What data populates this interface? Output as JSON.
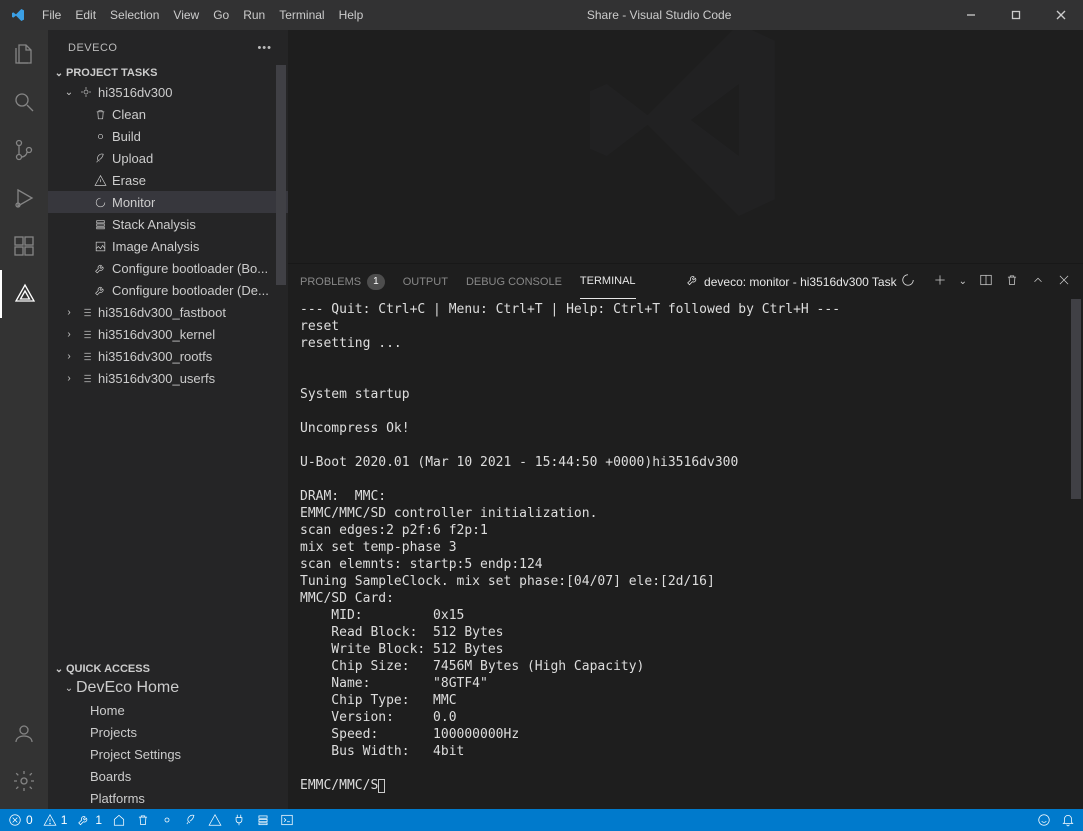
{
  "title": "Share - Visual Studio Code",
  "menu": [
    "File",
    "Edit",
    "Selection",
    "View",
    "Go",
    "Run",
    "Terminal",
    "Help"
  ],
  "sidebar_title": "DEVECO",
  "sections": {
    "project_tasks": "PROJECT TASKS",
    "quick_access": "QUICK ACCESS",
    "deveco_home": "DevEco Home"
  },
  "tree": {
    "root": "hi3516dv300",
    "tasks": [
      "Clean",
      "Build",
      "Upload",
      "Erase",
      "Monitor",
      "Stack Analysis",
      "Image Analysis",
      "Configure bootloader (Bo...",
      "Configure bootloader (De..."
    ],
    "task_icons": [
      "trash",
      "circle",
      "rocket",
      "warn",
      "spin",
      "stack",
      "image",
      "tools",
      "tools"
    ],
    "subs": [
      "hi3516dv300_fastboot",
      "hi3516dv300_kernel",
      "hi3516dv300_rootfs",
      "hi3516dv300_userfs"
    ]
  },
  "quick_access_items": [
    "Home",
    "Projects",
    "Project Settings",
    "Boards",
    "Platforms"
  ],
  "panel": {
    "tabs": {
      "problems": "PROBLEMS",
      "problems_badge": "1",
      "output": "OUTPUT",
      "debug": "DEBUG CONSOLE",
      "terminal": "TERMINAL"
    },
    "task_label": "deveco: monitor - hi3516dv300 Task"
  },
  "terminal_lines": [
    "--- Quit: Ctrl+C | Menu: Ctrl+T | Help: Ctrl+T followed by Ctrl+H ---",
    "reset",
    "resetting ...",
    "",
    "",
    "System startup",
    "",
    "Uncompress Ok!",
    "",
    "U-Boot 2020.01 (Mar 10 2021 - 15:44:50 +0000)hi3516dv300",
    "",
    "DRAM:  MMC:",
    "EMMC/MMC/SD controller initialization.",
    "scan edges:2 p2f:6 f2p:1",
    "mix set temp-phase 3",
    "scan elemnts: startp:5 endp:124",
    "Tuning SampleClock. mix set phase:[04/07] ele:[2d/16]",
    "MMC/SD Card:",
    "    MID:         0x15",
    "    Read Block:  512 Bytes",
    "    Write Block: 512 Bytes",
    "    Chip Size:   7456M Bytes (High Capacity)",
    "    Name:        \"8GTF4\"",
    "    Chip Type:   MMC",
    "    Version:     0.0",
    "    Speed:       100000000Hz",
    "    Bus Width:   4bit",
    "",
    "EMMC/MMC/S"
  ],
  "status": {
    "err": "0",
    "warn": "1",
    "tools": "1"
  }
}
